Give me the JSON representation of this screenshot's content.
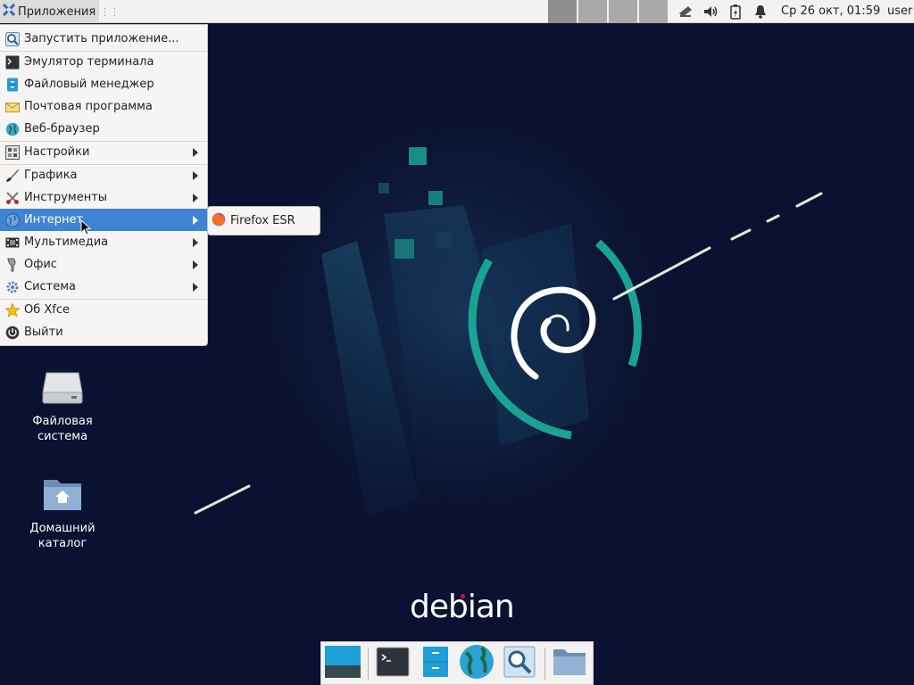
{
  "panel": {
    "apps_button_label": "Приложения",
    "clock": "Ср 26 окт, 01:59",
    "user": "user",
    "tray_icons": [
      "network-icon",
      "volume-icon",
      "battery-icon",
      "notification-bell-icon"
    ]
  },
  "menu": {
    "items": [
      {
        "label": "Запустить приложение...",
        "icon": "search-app-icon"
      },
      {
        "label": "Эмулятор терминала",
        "icon": "terminal-icon"
      },
      {
        "label": "Файловый менеджер",
        "icon": "file-manager-icon"
      },
      {
        "label": "Почтовая программа",
        "icon": "mail-icon"
      },
      {
        "label": "Веб-браузер",
        "icon": "web-browser-icon"
      },
      {
        "label": "Настройки",
        "icon": "settings-icon",
        "submenu": true
      },
      {
        "label": "Графика",
        "icon": "graphics-icon",
        "submenu": true
      },
      {
        "label": "Инструменты",
        "icon": "tools-icon",
        "submenu": true
      },
      {
        "label": "Интернет",
        "icon": "internet-icon",
        "submenu": true,
        "highlighted": true
      },
      {
        "label": "Мультимедиа",
        "icon": "multimedia-icon",
        "submenu": true
      },
      {
        "label": "Офис",
        "icon": "office-icon",
        "submenu": true
      },
      {
        "label": "Система",
        "icon": "system-icon",
        "submenu": true
      },
      {
        "label": "Об Xfce",
        "icon": "about-star-icon"
      },
      {
        "label": "Выйти",
        "icon": "logout-icon"
      }
    ],
    "submenu_internet": [
      {
        "label": "Firefox ESR",
        "icon": "firefox-icon"
      }
    ],
    "highlight_color": "#3e84d3"
  },
  "desktop": {
    "icons": [
      {
        "label_line1": "Файловая",
        "label_line2": "система",
        "icon": "drive-icon"
      },
      {
        "label_line1": "Домашний",
        "label_line2": "каталог",
        "icon": "home-folder-icon"
      }
    ],
    "logo_text": "debian",
    "background_color": "#0b1130",
    "accent_color": "#1aa394"
  },
  "dock": {
    "items": [
      "show-desktop-icon",
      "terminal-icon",
      "file-manager-icon",
      "web-browser-icon",
      "app-finder-icon",
      "folder-icon"
    ]
  }
}
